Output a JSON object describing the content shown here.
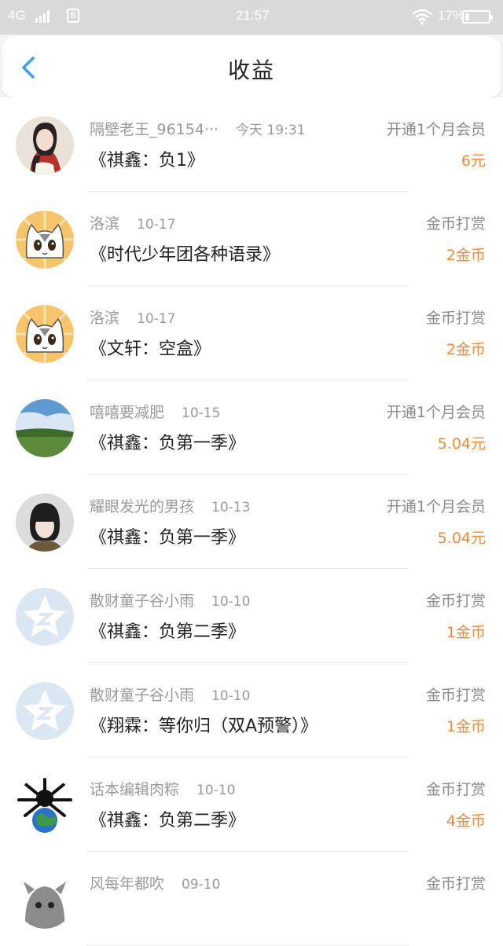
{
  "status_bar": {
    "carrier": "4G",
    "time": "21:57",
    "battery": "17%",
    "battery_level": 0.17
  },
  "header": {
    "title": "收益"
  },
  "earnings": [
    {
      "name": "隔壁老王_96154···",
      "date": "今天 19:31",
      "work": "《祺鑫：负1》",
      "type": "开通1个月会员",
      "amount": "6元",
      "avatar": "girl-portrait"
    },
    {
      "name": "洛滨",
      "date": "10-17",
      "work": "《时代少年团各种语录》",
      "type": "金币打赏",
      "amount": "2金币",
      "avatar": "cartoon-cat"
    },
    {
      "name": "洛滨",
      "date": "10-17",
      "work": "《文轩：空盒》",
      "type": "金币打赏",
      "amount": "2金币",
      "avatar": "cartoon-cat"
    },
    {
      "name": "嘻嘻要减肥",
      "date": "10-15",
      "work": "《祺鑫：负第一季》",
      "type": "开通1个月会员",
      "amount": "5.04元",
      "avatar": "landscape"
    },
    {
      "name": "耀眼发光的男孩",
      "date": "10-13",
      "work": "《祺鑫：负第一季》",
      "type": "开通1个月会员",
      "amount": "5.04元",
      "avatar": "person-photo"
    },
    {
      "name": "散财童子谷小雨",
      "date": "10-10",
      "work": "《祺鑫：负第二季》",
      "type": "金币打赏",
      "amount": "1金币",
      "avatar": "default-star"
    },
    {
      "name": "散财童子谷小雨",
      "date": "10-10",
      "work": "《翔霖：等你归（双A预警）》",
      "type": "金币打赏",
      "amount": "1金币",
      "avatar": "default-star"
    },
    {
      "name": "话本编辑肉粽",
      "date": "10-10",
      "work": "《祺鑫：负第二季》",
      "type": "金币打赏",
      "amount": "4金币",
      "avatar": "spider-earth"
    },
    {
      "name": "风每年都吹",
      "date": "09-10",
      "work": "",
      "type": "金币打赏",
      "amount": "",
      "avatar": "gray-character"
    }
  ]
}
